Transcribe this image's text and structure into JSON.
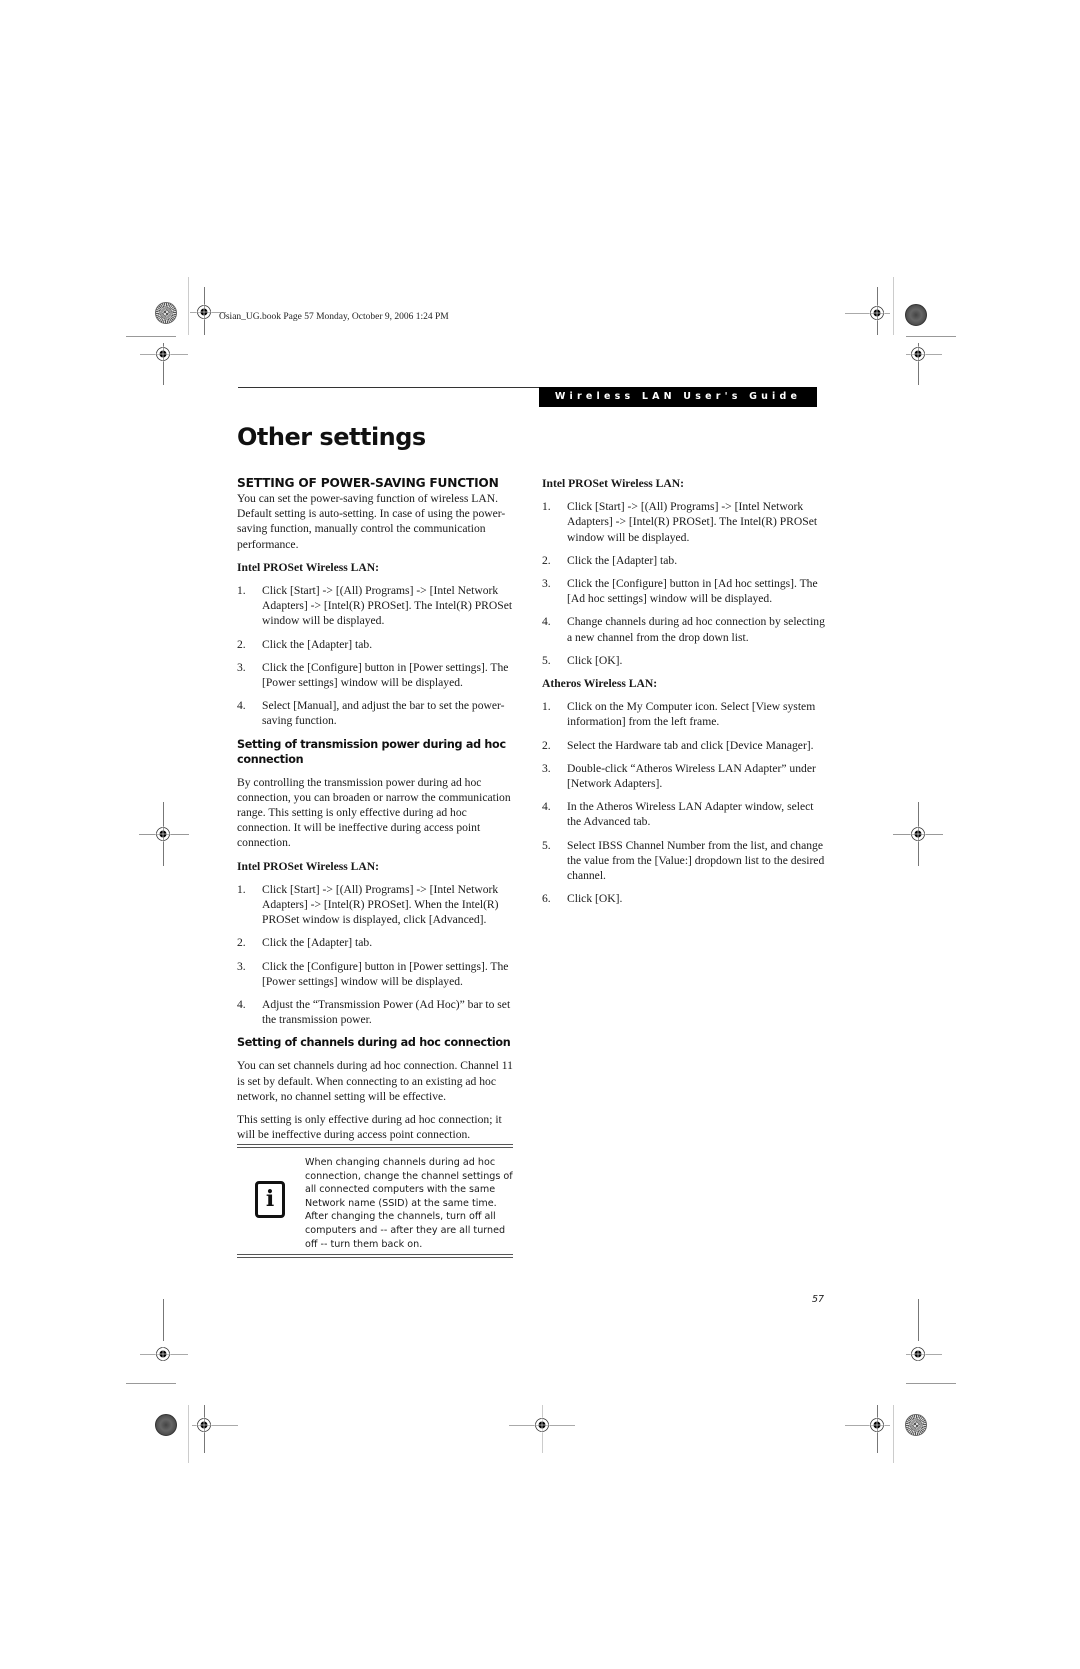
{
  "slug": "Osian_UG.book  Page 57  Monday, October 9, 2006  1:24 PM",
  "running_header": "Wireless LAN User's Guide",
  "page_title": "Other settings",
  "page_number": "57",
  "left_column": {
    "section_heading": "SETTING OF POWER-SAVING FUNCTION",
    "intro": "You can set the power-saving function of wireless LAN. Default setting is auto-setting. In case of using the power-saving function, manually control the communication performance.",
    "power_saving": {
      "subheading": "Intel PROSet Wireless LAN:",
      "steps": [
        {
          "num": "1.",
          "text": "Click [Start] -> [(All) Programs] -> [Intel Network Adapters] -> [Intel(R) PROSet]. The Intel(R) PROSet window will be displayed."
        },
        {
          "num": "2.",
          "text": "Click the [Adapter] tab."
        },
        {
          "num": "3.",
          "text": "Click the [Configure] button in [Power settings]. The [Power settings] window will be displayed."
        },
        {
          "num": "4.",
          "text": "Select [Manual], and adjust the bar to set the power-saving function."
        }
      ]
    },
    "transmission": {
      "heading": "Setting of transmission power during ad hoc connection",
      "body": "By controlling the transmission power during ad hoc connection, you can broaden or narrow the communication range. This setting is only effective during ad hoc connection. It will be ineffective during access point connection.",
      "subheading": "Intel PROSet Wireless LAN:",
      "steps": [
        {
          "num": "1.",
          "text": "Click [Start] -> [(All) Programs] -> [Intel Network Adapters] -> [Intel(R) PROSet]. When the Intel(R) PROSet window is displayed, click [Advanced]."
        },
        {
          "num": "2.",
          "text": "Click the [Adapter] tab."
        },
        {
          "num": "3.",
          "text": "Click the [Configure] button in [Power settings]. The [Power settings] window will be displayed."
        },
        {
          "num": "4.",
          "text": "Adjust the “Transmission Power (Ad Hoc)” bar to set the transmission power."
        }
      ]
    },
    "channels": {
      "heading": "Setting of channels during ad hoc connection",
      "body1": "You can set channels during ad hoc connection. Channel 11 is set by default. When connecting to an existing ad hoc network, no channel setting will be effective.",
      "body2": "This setting is only effective during ad hoc connection; it will be ineffective during access point connection."
    },
    "note": {
      "icon": "info-icon",
      "icon_glyph": "i",
      "text": "When changing channels during ad hoc connection, change the channel settings of all connected computers with the same Network name (SSID) at the same time. After changing the channels, turn off all computers and -- after they are all turned off -- turn them back on."
    }
  },
  "right_column": {
    "intel": {
      "subheading": "Intel PROSet Wireless LAN:",
      "steps": [
        {
          "num": "1.",
          "text": "Click [Start] -> [(All) Programs] -> [Intel Network Adapters] -> [Intel(R) PROSet]. The Intel(R) PROSet window will be displayed."
        },
        {
          "num": "2.",
          "text": "Click the [Adapter] tab."
        },
        {
          "num": "3.",
          "text": "Click the [Configure] button in [Ad hoc settings]. The [Ad hoc settings] window will be displayed."
        },
        {
          "num": "4.",
          "text": "Change channels during ad hoc connection by selecting a new channel from the drop down list."
        },
        {
          "num": "5.",
          "text": "Click [OK]."
        }
      ]
    },
    "atheros": {
      "subheading": "Atheros Wireless LAN:",
      "steps": [
        {
          "num": "1.",
          "text": "Click on the My Computer icon. Select [View system information] from the left frame."
        },
        {
          "num": "2.",
          "text": "Select the Hardware tab and click [Device Manager]."
        },
        {
          "num": "3.",
          "text": "Double-click “Atheros Wireless LAN Adapter” under [Network Adapters]."
        },
        {
          "num": "4.",
          "text": "In the Atheros Wireless LAN Adapter window, select the Advanced tab."
        },
        {
          "num": "5.",
          "text": "Select IBSS Channel Number from the list, and change the value from the [Value:] dropdown list to the desired channel."
        },
        {
          "num": "6.",
          "text": "Click [OK]."
        }
      ]
    }
  }
}
